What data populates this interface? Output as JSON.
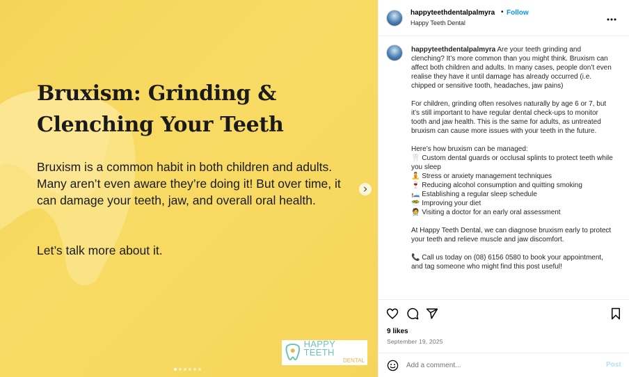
{
  "media": {
    "headline": "Bruxism: Grinding &\nClenching Your Teeth",
    "body": "Bruxism is a common habit in both children and adults. Many aren’t even aware they’re doing it! But over time, it can damage your teeth, jaw, and overall oral health.",
    "cta": "Let’s talk more about it.",
    "logo_line1": "HAPPY TEETH",
    "logo_line2": "DENTAL",
    "carousel_total": 6,
    "carousel_active": 1,
    "background_color": "#f6d55b"
  },
  "header": {
    "username": "happyteethdentalpalmyra",
    "dot": "•",
    "follow_label": "Follow",
    "subtitle": "Happy Teeth Dental",
    "more_icon": "more-horizontal-icon"
  },
  "caption": {
    "username": "happyteethdentalpalmyra",
    "intro": "Are your teeth grinding and clenching? It’s more common than you might think. Bruxism can affect both children and adults. In many cases, people don’t even realise they have it until damage has already occurred (i.e. chipped or sensitive tooth, headaches, jaw pains)",
    "para2": "For children, grinding often resolves naturally by age 6 or 7, but it’s still important to have regular dental check-ups to monitor tooth and jaw health. This is the same for adults, as untreated bruxism can cause more issues with your teeth in the future.",
    "list_title": "Here’s how bruxism can be managed:",
    "list": [
      {
        "emoji": "🦷",
        "text": "Custom dental guards or occlusal splints to protect teeth while you sleep"
      },
      {
        "emoji": "🧘",
        "text": "Stress or anxiety management techniques"
      },
      {
        "emoji": "🍷",
        "text": "Reducing alcohol consumption and quitting smoking"
      },
      {
        "emoji": "🛏️",
        "text": "Establishing a regular sleep schedule"
      },
      {
        "emoji": "🥗",
        "text": "Improving your diet"
      },
      {
        "emoji": "🧑‍⚕️",
        "text": "Visiting a doctor for an early oral assessment"
      }
    ],
    "para3": "At Happy Teeth Dental, we can diagnose bruxism early to protect your teeth and relieve muscle and jaw discomfort.",
    "call_emoji": "📞",
    "para4": "Call us today on (08) 6156 0580 to book your appointment, and tag someone who might find this post useful!"
  },
  "actions": {
    "like_icon": "heart-icon",
    "comment_icon": "comment-icon",
    "share_icon": "send-icon",
    "save_icon": "bookmark-icon"
  },
  "likes": "9 likes",
  "date": "September 19, 2025",
  "comment": {
    "placeholder": "Add a comment...",
    "post_label": "Post",
    "post_color": "#b2dffc"
  },
  "colors": {
    "accent": "#0095f6",
    "logo_teal": "#6cc4b8",
    "logo_gold": "#e3b44a"
  }
}
